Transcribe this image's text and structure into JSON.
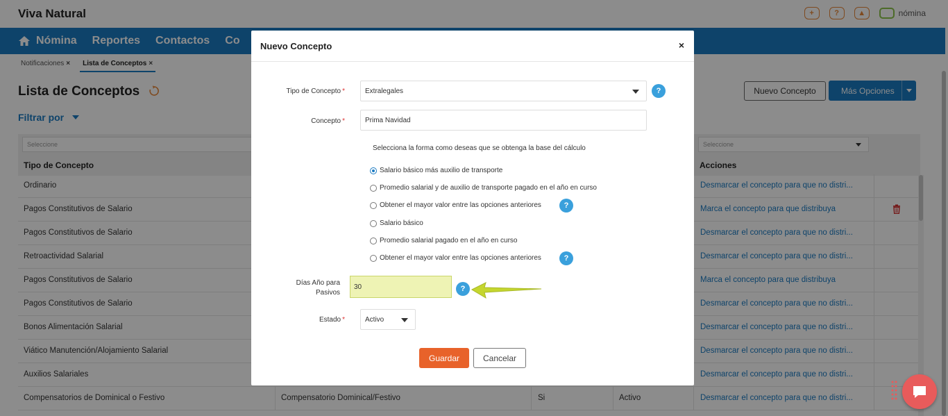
{
  "app": {
    "brand": "Viva Natural",
    "logo_text": "nómina",
    "top_icons": [
      "plus-icon",
      "help-icon",
      "user-icon"
    ]
  },
  "nav": {
    "items": [
      "Nómina",
      "Reportes",
      "Contactos",
      "Co"
    ]
  },
  "breadcrumbs": [
    {
      "label": "Notificaciones",
      "close": "×"
    },
    {
      "label": "Lista de Conceptos",
      "close": "×"
    }
  ],
  "page": {
    "title": "Lista de Conceptos",
    "filter_label": "Filtrar por",
    "new_button": "Nuevo Concepto",
    "more_button": "Más Opciones"
  },
  "table": {
    "filter_placeholder": "Seleccione",
    "headers": {
      "tipo": "Tipo de Concepto",
      "acciones": "Acciones"
    },
    "rows": [
      {
        "tipo": "Ordinario",
        "accion": "Desmarcar el concepto para que no distri..."
      },
      {
        "tipo": "Pagos Constitutivos de Salario",
        "accion": "Marca el concepto para que distribuya"
      },
      {
        "tipo": "Pagos Constitutivos de Salario",
        "accion": "Desmarcar el concepto para que no distri..."
      },
      {
        "tipo": "Retroactividad Salarial",
        "accion": "Desmarcar el concepto para que no distri..."
      },
      {
        "tipo": "Pagos Constitutivos de Salario",
        "accion": "Marca el concepto para que distribuya"
      },
      {
        "tipo": "Pagos Constitutivos de Salario",
        "accion": "Desmarcar el concepto para que no distri..."
      },
      {
        "tipo": "Bonos Alimentación Salarial",
        "accion": "Desmarcar el concepto para que no distri..."
      },
      {
        "tipo": "Viático Manutención/Alojamiento Salarial",
        "accion": "Desmarcar el concepto para que no distri..."
      },
      {
        "tipo": "Auxilios Salariales",
        "accion": "Desmarcar el concepto para que no distri..."
      },
      {
        "tipo": "Compensatorios de Dominical o Festivo",
        "concepto": "Compensatorio Dominical/Festivo",
        "col3": "Si",
        "estado": "Activo",
        "accion": "Desmarcar el concepto para que no distri..."
      }
    ]
  },
  "modal": {
    "title": "Nuevo Concepto",
    "close": "×",
    "tipo_label": "Tipo de Concepto",
    "tipo_value": "Extralegales",
    "concepto_label": "Concepto",
    "concepto_value": "Prima Navidad",
    "required_mark": "*",
    "instruction": "Selecciona la forma como deseas que se obtenga la base del cálculo",
    "options": [
      "Salario básico más auxilio de transporte",
      "Promedio salarial y de auxilio de transporte pagado en el año en curso",
      "Obtener el mayor valor entre las opciones anteriores",
      "Salario básico",
      "Promedio salarial pagado en el año en curso",
      "Obtener el mayor valor entre las opciones anteriores"
    ],
    "selected_option": 0,
    "dias_label_1": "Días Año para",
    "dias_label_2": "Pasivos",
    "dias_value": "30",
    "estado_label": "Estado",
    "estado_value": "Activo",
    "save": "Guardar",
    "cancel": "Cancelar",
    "help_glyph": "?"
  },
  "colors": {
    "nav": "#1a7ac2",
    "accent_orange": "#e8622a",
    "help_blue": "#3aa0dc",
    "highlight": "#eef3b4",
    "arrow": "#c5d62e"
  }
}
